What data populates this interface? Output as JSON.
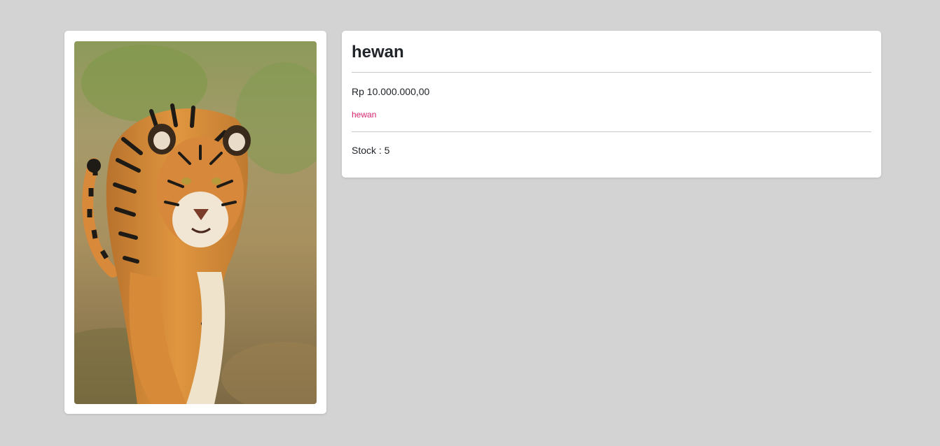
{
  "product": {
    "name": "hewan",
    "price": "Rp 10.000.000,00",
    "category": "hewan",
    "stock": "Stock : 5",
    "image_subject": "tiger"
  },
  "colors": {
    "page_background": "#d3d3d3",
    "card_background": "#ffffff",
    "category_text": "#d6246e"
  }
}
